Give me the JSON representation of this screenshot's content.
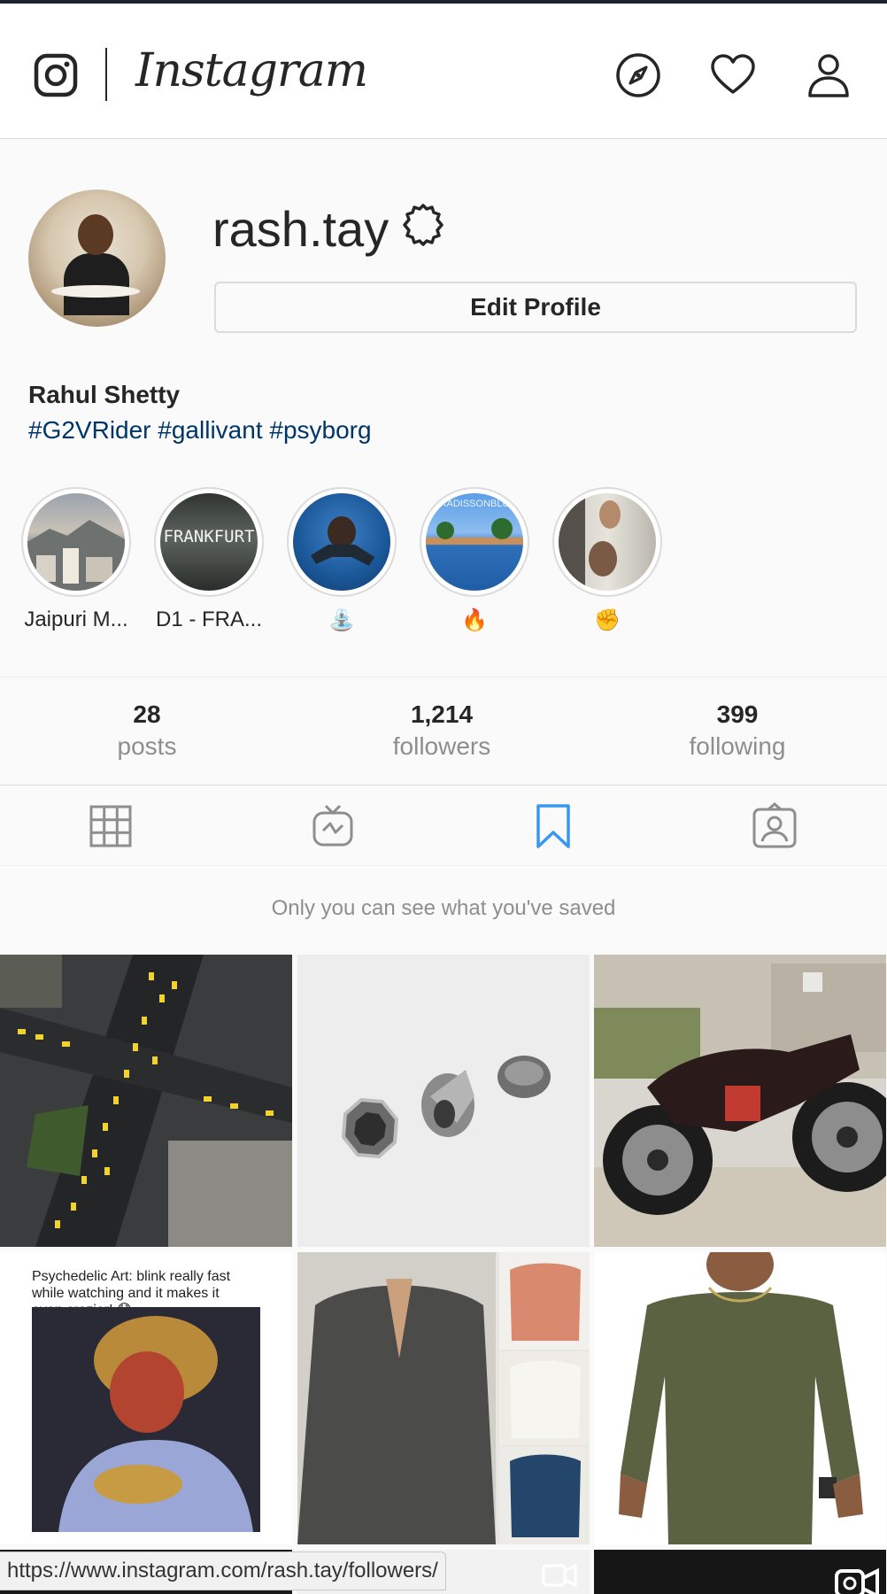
{
  "nav": {
    "wordmark": "Instagram",
    "icons": [
      "instagram-logo-icon",
      "compass-icon",
      "heart-icon",
      "user-icon"
    ]
  },
  "profile": {
    "username": "rash.tay",
    "edit_label": "Edit Profile",
    "full_name": "Rahul Shetty",
    "bio": "#G2VRider #gallivant #psyborg"
  },
  "highlights": [
    {
      "label": "Jaipuri M..."
    },
    {
      "label": "D1 - FRA...",
      "image_text": "FRANKFURT"
    },
    {
      "label": "⛲"
    },
    {
      "label": "🔥",
      "image_text": "RADISSONBLU"
    },
    {
      "label": "✊"
    }
  ],
  "stats": {
    "posts": {
      "count": "28",
      "label": "posts"
    },
    "followers": {
      "count": "1,214",
      "label": "followers"
    },
    "following": {
      "count": "399",
      "label": "following"
    }
  },
  "tabs": [
    "grid-icon",
    "igtv-icon",
    "bookmark-icon",
    "tagged-icon"
  ],
  "active_tab": "saved",
  "saved_note": "Only you can see what you've saved",
  "grid": {
    "tile4_caption": "Psychedelic Art: blink really fast while watching and it makes it even crazier! 😱"
  },
  "status_url": "https://www.instagram.com/rash.tay/followers/",
  "colors": {
    "text": "#262626",
    "secondary": "#8e8e8e",
    "link": "#003569",
    "active_tab": "#3897f0",
    "border": "#dbdbdb"
  }
}
